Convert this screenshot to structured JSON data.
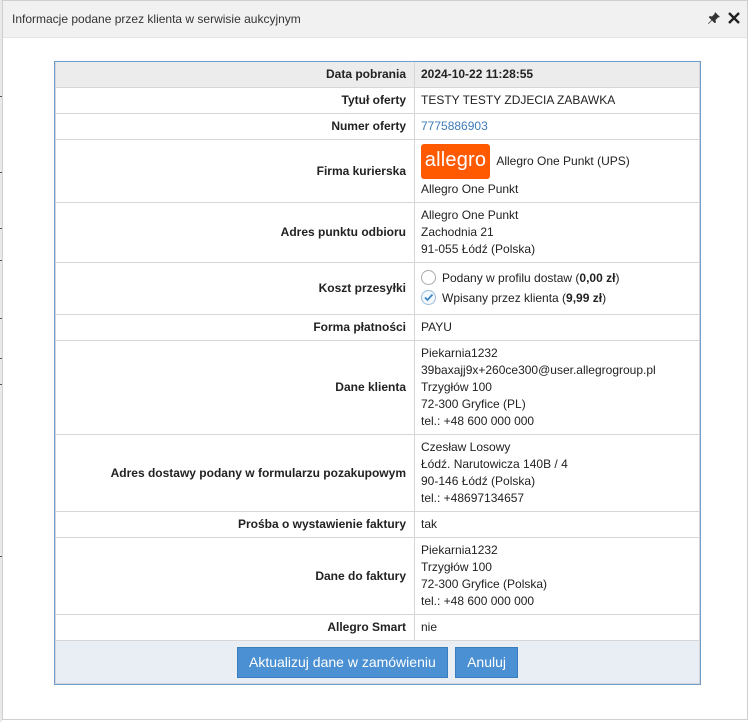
{
  "dialog": {
    "title": "Informacje podane przez klienta w serwisie aukcyjnym",
    "icons": [
      "pin-icon",
      "close-icon"
    ]
  },
  "rows": {
    "date": {
      "label": "Data pobrania",
      "value": "2024-10-22 11:28:55"
    },
    "offer_title": {
      "label": "Tytuł oferty",
      "value": "TESTY TESTY ZDJECIA ZABAWKA"
    },
    "offer_number": {
      "label": "Numer oferty",
      "value": "7775886903"
    },
    "courier": {
      "label": "Firma kurierska",
      "logo_text": "allegro",
      "name": "Allegro One Punkt (UPS)",
      "sub": "Allegro One Punkt"
    },
    "pickup": {
      "label": "Adres punktu odbioru",
      "lines": [
        "Allegro One Punkt",
        "Zachodnia 21",
        "91-055 Łódź (Polska)"
      ]
    },
    "shipping_cost": {
      "label": "Koszt przesyłki",
      "option1": {
        "text": "Podany w profilu dostaw (",
        "amount": "0,00 zł",
        "close": ")"
      },
      "option2": {
        "text": "Wpisany przez klienta (",
        "amount": "9,99 zł",
        "close": ")"
      }
    },
    "payment": {
      "label": "Forma płatności",
      "value": "PAYU"
    },
    "client": {
      "label": "Dane klienta",
      "lines": [
        "Piekarnia1232",
        "39baxajj9x+260ce300@user.allegrogroup.pl",
        "Trzygłów 100",
        "72-300 Gryfice (PL)",
        "tel.: +48 600 000 000"
      ]
    },
    "delivery": {
      "label": "Adres dostawy podany w formularzu pozakupowym",
      "lines": [
        "Czesław Losowy",
        "Łódź. Narutowicza 140B / 4",
        "90-146 Łódź (Polska)",
        "tel.: +48697134657"
      ]
    },
    "invoice_request": {
      "label": "Prośba o wystawienie faktury",
      "value": "tak"
    },
    "invoice": {
      "label": "Dane do faktury",
      "lines": [
        "Piekarnia1232",
        "Trzygłów 100",
        "72-300 Gryfice (Polska)",
        "tel.: +48 600 000 000"
      ]
    },
    "smart": {
      "label": "Allegro Smart",
      "value": "nie"
    }
  },
  "buttons": {
    "update": "Aktualizuj dane w zamówieniu",
    "cancel": "Anuluj"
  }
}
